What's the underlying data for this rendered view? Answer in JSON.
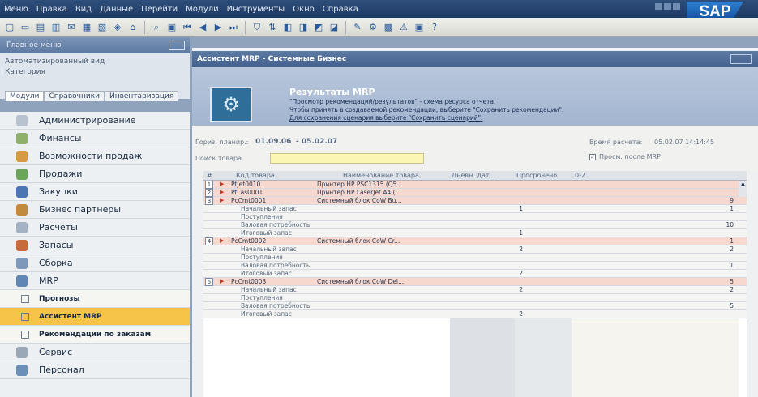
{
  "menubar": {
    "items": [
      "Меню",
      "Правка",
      "Вид",
      "Данные",
      "Перейти",
      "Модули",
      "Инструменты",
      "Окно",
      "Справка"
    ],
    "logo": "SAP"
  },
  "nav": {
    "top_title": "Главное меню",
    "header_lines": [
      "Автоматизированный вид",
      "Категория"
    ],
    "tabs": [
      "Модули",
      "Справочники",
      "Инвентаризация"
    ],
    "items": [
      {
        "label": "Администрирование",
        "icon": "folder-icon"
      },
      {
        "label": "Финансы",
        "icon": "finance-icon"
      },
      {
        "label": "Возможности продаж",
        "icon": "opportunity-icon"
      },
      {
        "label": "Продажи",
        "icon": "sales-icon"
      },
      {
        "label": "Закупки",
        "icon": "purchase-icon"
      },
      {
        "label": "Бизнес партнеры",
        "icon": "partners-icon"
      },
      {
        "label": "Расчеты",
        "icon": "banking-icon"
      },
      {
        "label": "Запасы",
        "icon": "inventory-icon"
      },
      {
        "label": "Сборка",
        "icon": "production-icon"
      },
      {
        "label": "MRP",
        "icon": "mrp-icon"
      }
    ],
    "subitems": [
      {
        "label": "Прогнозы",
        "active": false
      },
      {
        "label": "Ассистент MRP",
        "active": true
      },
      {
        "label": "Рекомендации по заказам",
        "active": false
      }
    ],
    "items_after": [
      {
        "label": "Сервис",
        "icon": "service-icon"
      },
      {
        "label": "Персонал",
        "icon": "personnel-icon"
      }
    ]
  },
  "main": {
    "title": "Ассистент MRP - Системные Бизнес",
    "banner": {
      "title": "Результаты MRP",
      "lines": [
        "\"Просмотр рекомендаций/результатов\" - схема ресурса отчета.",
        "Чтобы принять в создаваемой рекомендации, выберите \"Сохранить рекомендации\".",
        "Для сохранения сценария выберите \"Сохранить сценарий\"."
      ]
    },
    "filters": {
      "period_label": "Гориз. планир.:",
      "period_from": "01.09.06",
      "period_to": "- 05.02.07",
      "search_label": "Поиск товара",
      "calc_label": "Время расчета:",
      "calc_value": "05.02.07  14:14:45",
      "checkbox_label": "Просм. после MRP"
    },
    "columns": [
      "#",
      "Код товара",
      "Наименование товара",
      "Дневн. дат...",
      "Просрочено",
      "0-2"
    ],
    "rows": [
      {
        "n": "1",
        "code": "PtJet0010",
        "name": "Принтер HP PSC1315 (Q5...",
        "q1": "",
        "q2": "",
        "type": "main"
      },
      {
        "n": "2",
        "code": "PtLas0001",
        "name": "Принтер HP LaserJet A4 (...",
        "q1": "",
        "q2": "",
        "type": "main"
      },
      {
        "n": "3",
        "code": "PcCmt0001",
        "name": "Системный блок CoW Bu...",
        "q1": "",
        "q2": "9",
        "type": "main"
      },
      {
        "label": "Начальный запас",
        "q1": "1",
        "q2": "1",
        "type": "sub"
      },
      {
        "label": "Поступления",
        "q1": "",
        "q2": "",
        "type": "sub"
      },
      {
        "label": "Валовая потребность",
        "q1": "",
        "q2": "10",
        "type": "sub"
      },
      {
        "label": "Итоговый запас",
        "q1": "1",
        "q2": "",
        "type": "sub"
      },
      {
        "n": "4",
        "code": "PcCmt0002",
        "name": "Системный блок CoW Cr...",
        "q1": "",
        "q2": "1",
        "type": "main"
      },
      {
        "label": "Начальный запас",
        "q1": "2",
        "q2": "2",
        "type": "sub"
      },
      {
        "label": "Поступления",
        "q1": "",
        "q2": "",
        "type": "sub"
      },
      {
        "label": "Валовая потребность",
        "q1": "",
        "q2": "1",
        "type": "sub"
      },
      {
        "label": "Итоговый запас",
        "q1": "2",
        "q2": "",
        "type": "sub"
      },
      {
        "n": "5",
        "code": "PcCmt0003",
        "name": "Системный блок CoW Del...",
        "q1": "",
        "q2": "5",
        "type": "main"
      },
      {
        "label": "Начальный запас",
        "q1": "2",
        "q2": "2",
        "type": "sub"
      },
      {
        "label": "Поступления",
        "q1": "",
        "q2": "",
        "type": "sub"
      },
      {
        "label": "Валовая потребность",
        "q1": "",
        "q2": "5",
        "type": "sub"
      },
      {
        "label": "Итоговый запас",
        "q1": "2",
        "q2": "",
        "type": "sub"
      }
    ]
  }
}
